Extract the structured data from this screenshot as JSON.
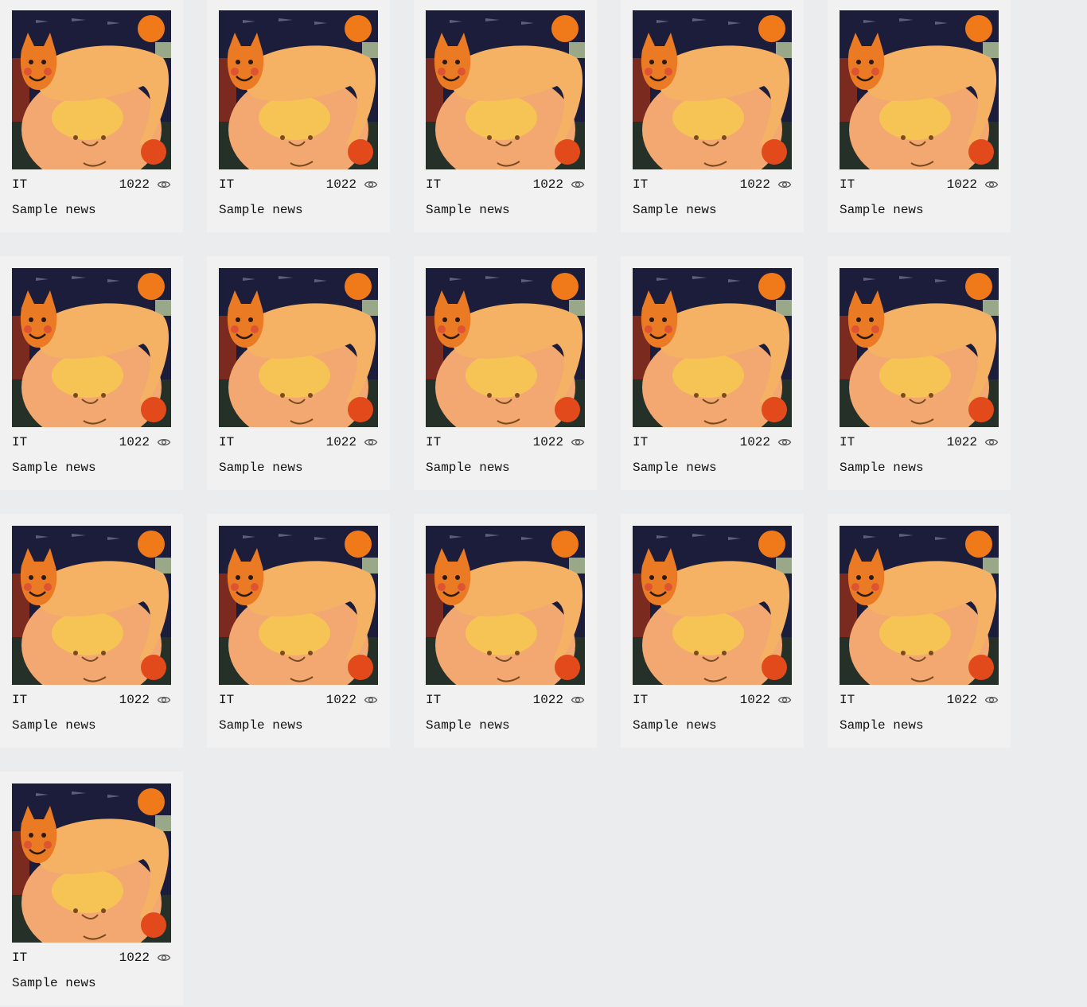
{
  "icons": {
    "thumbnail": "cat-on-moon-painting",
    "views": "eye-icon"
  },
  "colors": {
    "page_bg": "#ebecee",
    "card_bg": "#f1f1f1",
    "text": "#111111"
  },
  "news": [
    {
      "category": "IT",
      "views": "1022",
      "title": "Sample news"
    },
    {
      "category": "IT",
      "views": "1022",
      "title": "Sample news"
    },
    {
      "category": "IT",
      "views": "1022",
      "title": "Sample news"
    },
    {
      "category": "IT",
      "views": "1022",
      "title": "Sample news"
    },
    {
      "category": "IT",
      "views": "1022",
      "title": "Sample news"
    },
    {
      "category": "IT",
      "views": "1022",
      "title": "Sample news"
    },
    {
      "category": "IT",
      "views": "1022",
      "title": "Sample news"
    },
    {
      "category": "IT",
      "views": "1022",
      "title": "Sample news"
    },
    {
      "category": "IT",
      "views": "1022",
      "title": "Sample news"
    },
    {
      "category": "IT",
      "views": "1022",
      "title": "Sample news"
    },
    {
      "category": "IT",
      "views": "1022",
      "title": "Sample news"
    },
    {
      "category": "IT",
      "views": "1022",
      "title": "Sample news"
    },
    {
      "category": "IT",
      "views": "1022",
      "title": "Sample news"
    },
    {
      "category": "IT",
      "views": "1022",
      "title": "Sample news"
    },
    {
      "category": "IT",
      "views": "1022",
      "title": "Sample news"
    },
    {
      "category": "IT",
      "views": "1022",
      "title": "Sample news"
    }
  ]
}
